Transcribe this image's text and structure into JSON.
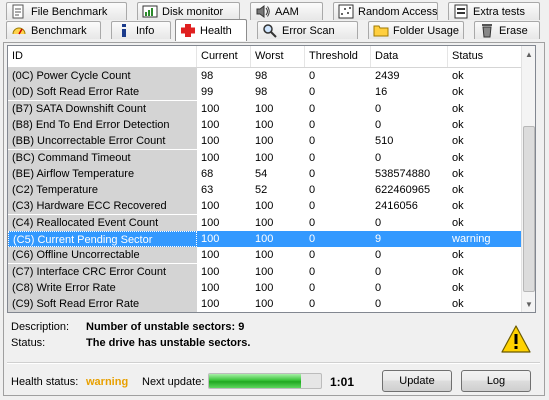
{
  "tabs": {
    "row1": [
      {
        "label": "File Benchmark",
        "icon": "file-benchmark-icon"
      },
      {
        "label": "Disk monitor",
        "icon": "disk-monitor-icon"
      },
      {
        "label": "AAM",
        "icon": "speaker-icon"
      },
      {
        "label": "Random Access",
        "icon": "random-access-icon"
      },
      {
        "label": "Extra tests",
        "icon": "extra-tests-icon"
      }
    ],
    "row2": [
      {
        "label": "Benchmark",
        "icon": "benchmark-icon"
      },
      {
        "label": "Info",
        "icon": "info-icon"
      },
      {
        "label": "Health",
        "icon": "health-cross-icon",
        "active": true
      },
      {
        "label": "Error Scan",
        "icon": "magnifier-icon"
      },
      {
        "label": "Folder Usage",
        "icon": "folder-icon"
      },
      {
        "label": "Erase",
        "icon": "trash-icon"
      }
    ]
  },
  "table": {
    "columns": [
      "ID",
      "Current",
      "Worst",
      "Threshold",
      "Data",
      "Status"
    ],
    "rows": [
      [
        "(0C) Power Cycle Count",
        "98",
        "98",
        "0",
        "2439",
        "ok"
      ],
      [
        "(0D) Soft Read Error Rate",
        "99",
        "98",
        "0",
        "16",
        "ok"
      ],
      [
        "(B7) SATA Downshift Count",
        "100",
        "100",
        "0",
        "0",
        "ok"
      ],
      [
        "(B8) End To End Error Detection",
        "100",
        "100",
        "0",
        "0",
        "ok"
      ],
      [
        "(BB) Uncorrectable Error Count",
        "100",
        "100",
        "0",
        "510",
        "ok"
      ],
      [
        "(BC) Command Timeout",
        "100",
        "100",
        "0",
        "0",
        "ok"
      ],
      [
        "(BE) Airflow Temperature",
        "68",
        "54",
        "0",
        "538574880",
        "ok"
      ],
      [
        "(C2) Temperature",
        "63",
        "52",
        "0",
        "622460965",
        "ok"
      ],
      [
        "(C3) Hardware ECC Recovered",
        "100",
        "100",
        "0",
        "2416056",
        "ok"
      ],
      [
        "(C4) Reallocated Event Count",
        "100",
        "100",
        "0",
        "0",
        "ok"
      ],
      [
        "(C5) Current Pending Sector",
        "100",
        "100",
        "0",
        "9",
        "warning"
      ],
      [
        "(C6) Offline Uncorrectable",
        "100",
        "100",
        "0",
        "0",
        "ok"
      ],
      [
        "(C7) Interface CRC Error Count",
        "100",
        "100",
        "0",
        "0",
        "ok"
      ],
      [
        "(C8) Write Error Rate",
        "100",
        "100",
        "0",
        "0",
        "ok"
      ],
      [
        "(C9) Soft Read Error Rate",
        "100",
        "100",
        "0",
        "0",
        "ok"
      ]
    ],
    "selected_row": 10
  },
  "description": {
    "label": "Description:",
    "value": "Number of unstable sectors: 9"
  },
  "status": {
    "label": "Status:",
    "value": "The drive has unstable sectors."
  },
  "footer": {
    "health_label": "Health status:",
    "health_value": "warning",
    "next_update_label": "Next update:",
    "progress_fraction": 0.82,
    "next_update_time": "1:01",
    "update_button": "Update",
    "log_button": "Log"
  },
  "colors": {
    "selection": "#3399ff",
    "warning": "#e8a000",
    "health_cross": "#e02020"
  }
}
